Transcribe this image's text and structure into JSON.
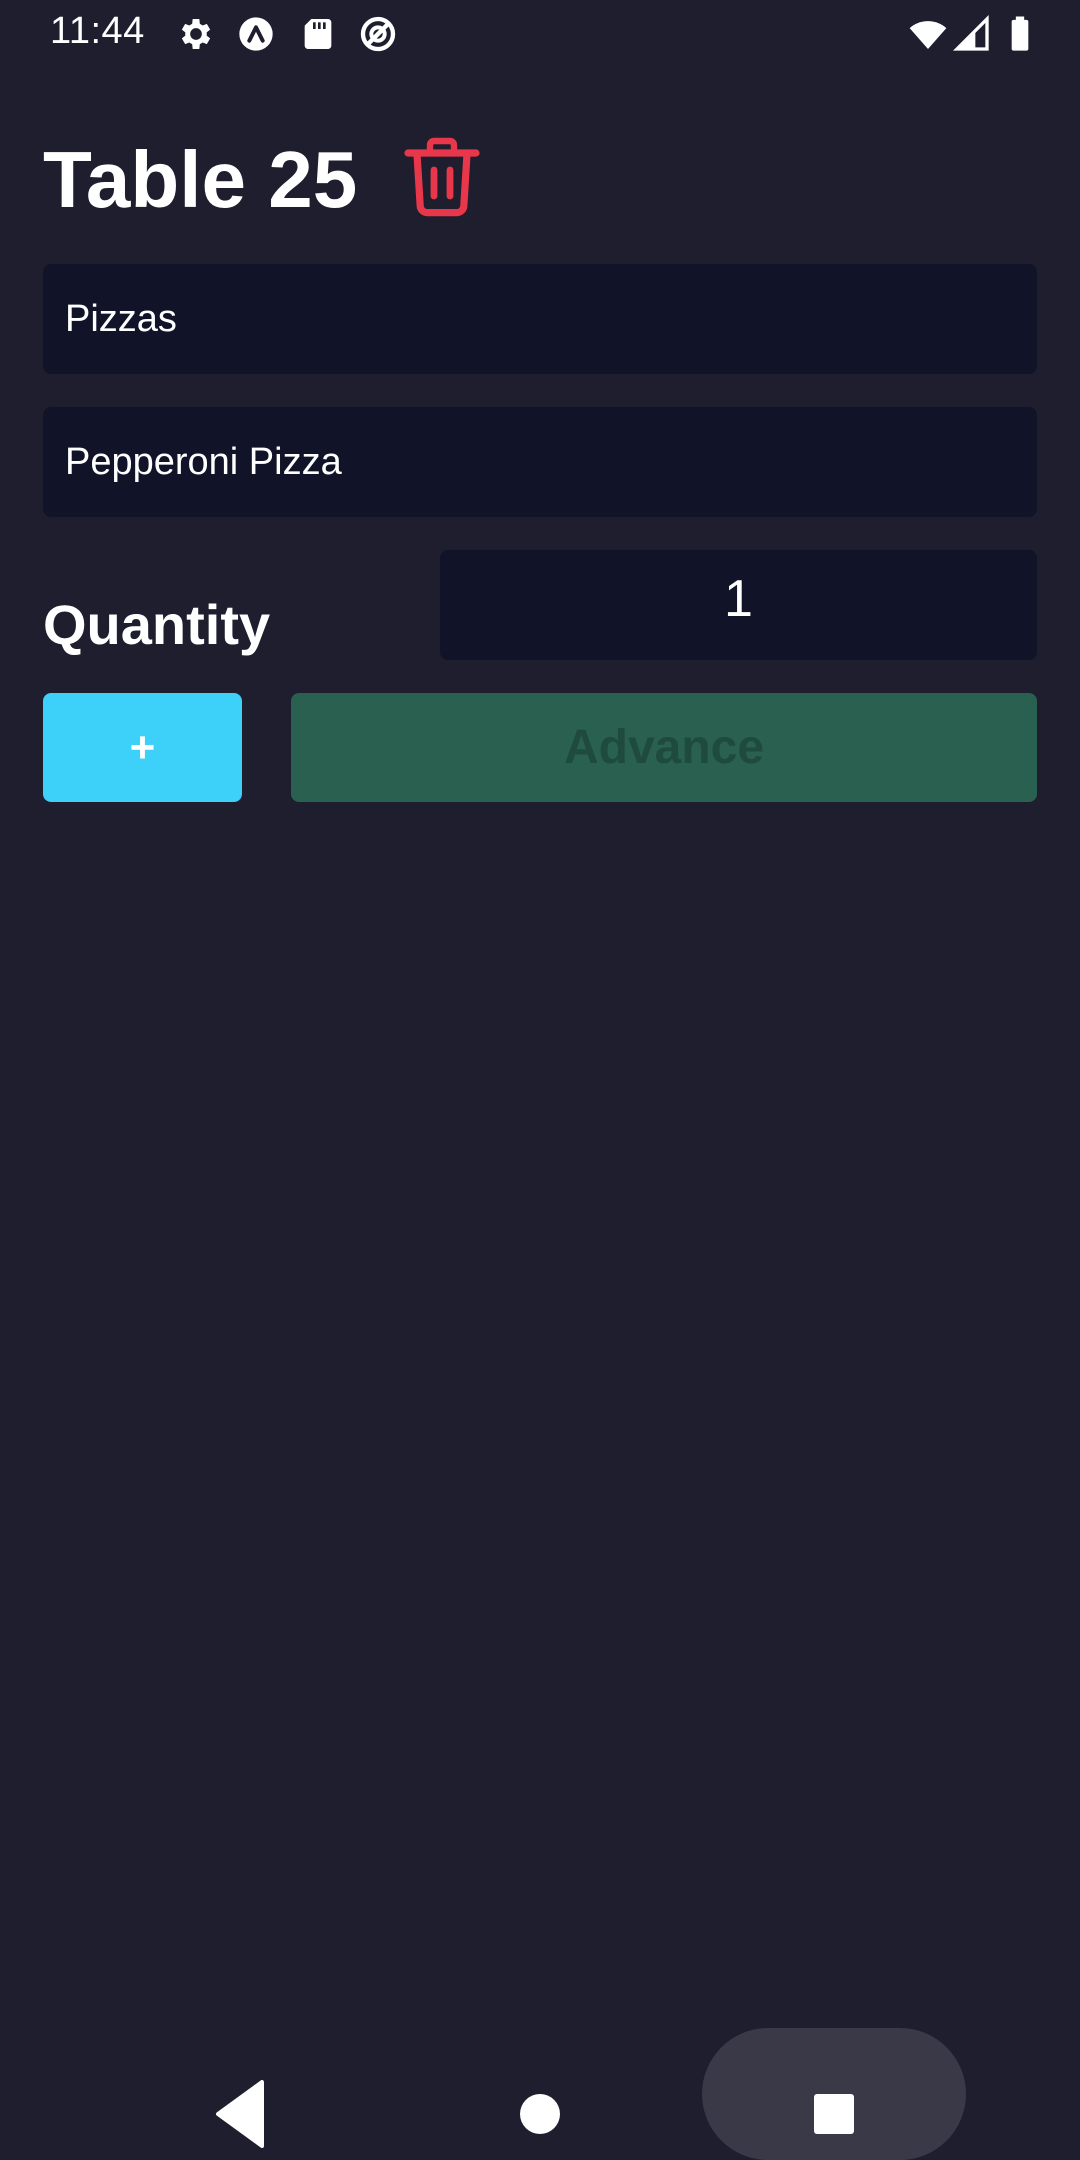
{
  "status_bar": {
    "time": "11:44",
    "left_icons": [
      "settings-icon",
      "app-launcher-icon",
      "sd-card-icon",
      "sync-icon"
    ],
    "right_icons": [
      "wifi-icon",
      "cellular-signal-icon",
      "battery-icon"
    ]
  },
  "header": {
    "title": "Table 25",
    "delete_icon": "trash-icon",
    "delete_color": "#e8374a"
  },
  "form": {
    "category_value": "Pizzas",
    "item_value": "Pepperoni Pizza",
    "quantity_label": "Quantity",
    "quantity_value": "1"
  },
  "actions": {
    "add_label": "+",
    "advance_label": "Advance",
    "add_color": "#3dd0f8",
    "advance_color": "#2a6050"
  },
  "nav_bar": {
    "buttons": [
      "back-icon",
      "home-icon",
      "recents-icon"
    ]
  }
}
